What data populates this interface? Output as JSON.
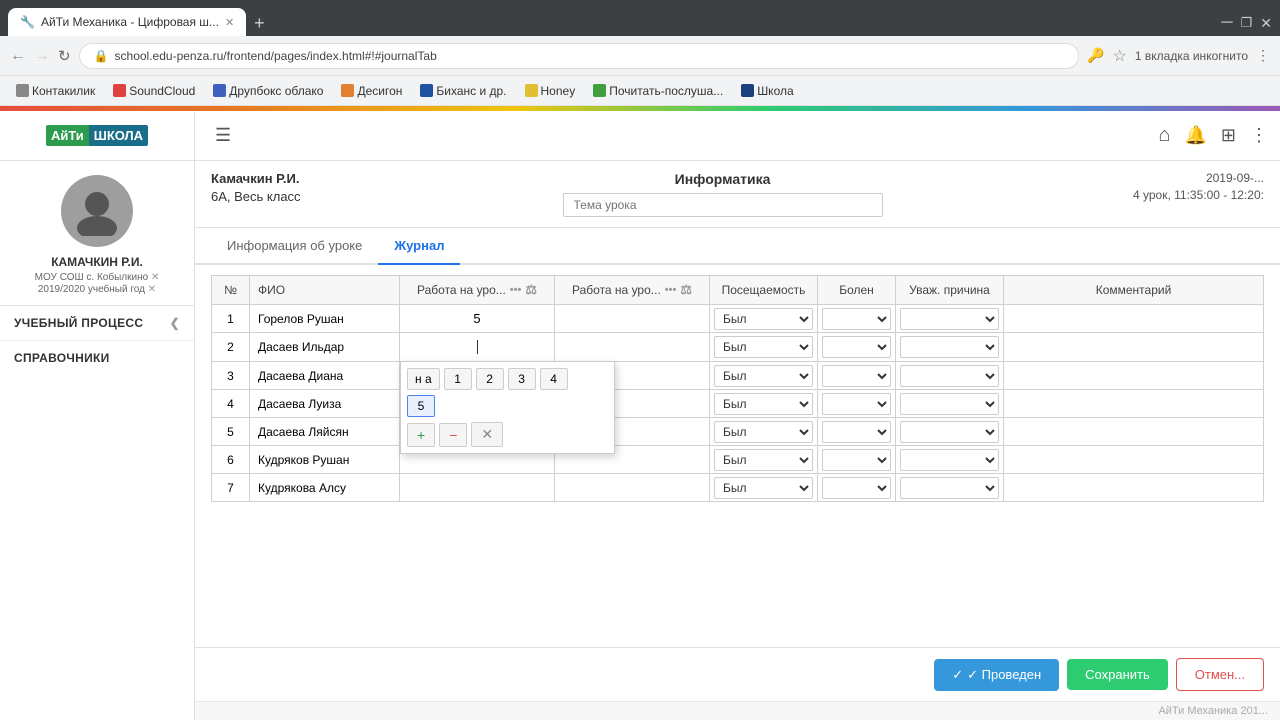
{
  "browser": {
    "tab_title": "АйТи Механика - Цифровая ш...",
    "tab_favicon": "🔧",
    "address": "school.edu-penza.ru/frontend/pages/index.html#!#journalTab",
    "incognito_label": "1 вкладка инкогнито",
    "bookmarks": [
      {
        "label": "Контакилик",
        "color": "gray"
      },
      {
        "label": "SoundCloud",
        "color": "red"
      },
      {
        "label": "Друпбокс облако",
        "color": "blue"
      },
      {
        "label": "Десигон",
        "color": "orange"
      },
      {
        "label": "Биханс и др.",
        "color": "blue"
      },
      {
        "label": "Honey",
        "color": "yellow"
      },
      {
        "label": "Почитать-послуша...",
        "color": "green"
      },
      {
        "label": "Школа",
        "color": "dblue"
      }
    ]
  },
  "logo": {
    "aiti": "АйТи",
    "shkola": "ШКОЛА"
  },
  "user": {
    "name": "КАМАЧКИН Р.И.",
    "org": "МОУ СОШ с. Кобылкино ✕",
    "year": "2019/2020 учебный год ✕"
  },
  "sidebar_menu": [
    {
      "label": "УЧЕБНЫЙ ПРОЦЕСС"
    },
    {
      "label": "СПРАВОЧНИКИ"
    }
  ],
  "lesson": {
    "teacher": "Камачкин Р.И.",
    "class": "6А, Весь класс",
    "subject": "Информатика",
    "topic_placeholder": "Тема урока",
    "date": "2019-09-...",
    "lesson_num": "4 урок, 11:35:00 - 12:20:"
  },
  "tabs": [
    {
      "label": "Информация об уроке"
    },
    {
      "label": "Журнал"
    }
  ],
  "active_tab": 1,
  "table": {
    "headers": {
      "num": "№",
      "name": "ФИО",
      "work1": "Работа на уро...",
      "work2": "Работа на уро...",
      "attendance": "Посещаемость",
      "sick": "Болен",
      "reason": "Уваж. причина",
      "comment": "Комментарий"
    },
    "rows": [
      {
        "num": 1,
        "name": "Горелов Рушан",
        "grade1": "5",
        "grade2": "",
        "attendance": "Был",
        "sick": "",
        "reason": "",
        "comment": ""
      },
      {
        "num": 2,
        "name": "Дасаев Ильдар",
        "grade1": "",
        "grade2": "",
        "attendance": "Был",
        "sick": "",
        "reason": "",
        "comment": "",
        "active": true
      },
      {
        "num": 3,
        "name": "Дасаева Диана",
        "grade1": "",
        "grade2": "",
        "attendance": "Был",
        "sick": "",
        "reason": "",
        "comment": ""
      },
      {
        "num": 4,
        "name": "Дасаева Луиза",
        "grade1": "",
        "grade2": "",
        "attendance": "Был",
        "sick": "",
        "reason": "",
        "comment": ""
      },
      {
        "num": 5,
        "name": "Дасаева Ляйсян",
        "grade1": "",
        "grade2": "",
        "attendance": "Был",
        "sick": "",
        "reason": "",
        "comment": ""
      },
      {
        "num": 6,
        "name": "Кудряков Рушан",
        "grade1": "",
        "grade2": "",
        "attendance": "Был",
        "sick": "",
        "reason": "",
        "comment": ""
      },
      {
        "num": 7,
        "name": "Кудрякова Алсу",
        "grade1": "",
        "grade2": "",
        "attendance": "Был",
        "sick": "",
        "reason": "",
        "comment": ""
      }
    ],
    "grade_popup": {
      "options": [
        "н а",
        "1",
        "2",
        "3",
        "4",
        "5"
      ],
      "selected": "5"
    }
  },
  "footer": {
    "provedyon_label": "✓  Проведен",
    "save_label": "Сохранить",
    "cancel_label": "Отмен...",
    "watermark": "АйТи Механика 201..."
  }
}
